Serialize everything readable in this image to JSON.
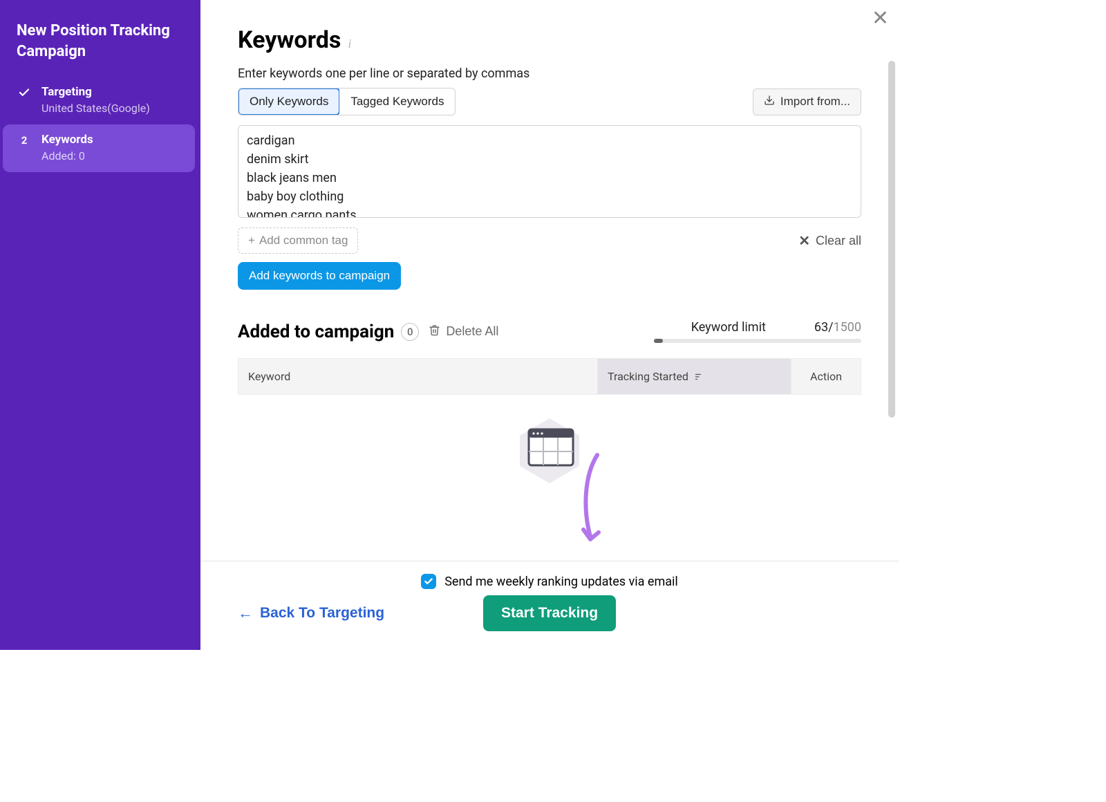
{
  "sidebar": {
    "title": "New Position Tracking Campaign",
    "steps": [
      {
        "label": "Targeting",
        "sub": "United States(Google)",
        "completed": true
      },
      {
        "label": "Keywords",
        "sub": "Added: 0",
        "index": "2",
        "active": true
      }
    ]
  },
  "page": {
    "title": "Keywords",
    "subtitle": "Enter keywords one per line or separated by commas"
  },
  "tabs": {
    "only": "Only Keywords",
    "tagged": "Tagged Keywords"
  },
  "import_label": "Import from...",
  "keywords_text": "cardigan\ndenim skirt\nblack jeans men\nbaby boy clothing\nwomen cargo pants",
  "add_common_tag": "Add common tag",
  "clear_all": "Clear all",
  "add_keywords_btn": "Add keywords to campaign",
  "campaign": {
    "title": "Added to campaign",
    "count": "0",
    "delete_all": "Delete All",
    "limit_label": "Keyword limit",
    "limit_used": "63",
    "limit_sep": "/",
    "limit_max": "1500"
  },
  "table": {
    "col_keyword": "Keyword",
    "col_tracking": "Tracking Started",
    "col_action": "Action"
  },
  "footer": {
    "email_opt": "Send me weekly ranking updates via email",
    "back": "Back To Targeting",
    "start": "Start Tracking"
  }
}
